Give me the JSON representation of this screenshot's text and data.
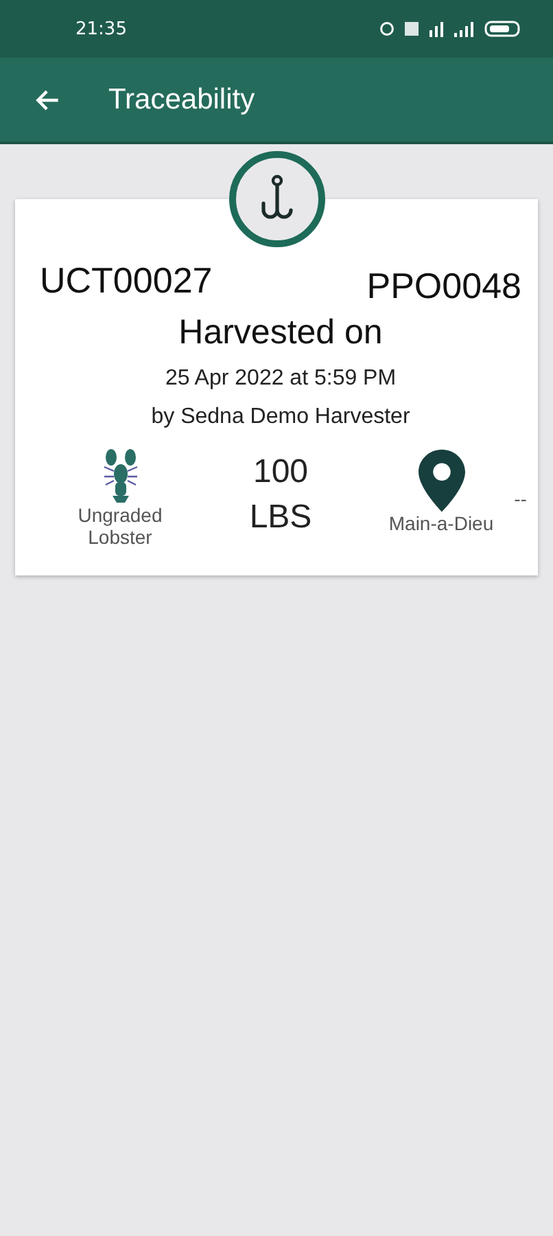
{
  "status_bar": {
    "time": "21:35"
  },
  "app_bar": {
    "title": "Traceability"
  },
  "card": {
    "lot_id": "UCT00027",
    "order_id": "PPO0048",
    "heading": "Harvested on",
    "date": "25 Apr 2022 at 5:59 PM",
    "by": "by Sedna Demo Harvester",
    "species": {
      "label": "Ungraded Lobster"
    },
    "quantity": {
      "amount": "100",
      "unit": "LBS"
    },
    "location": {
      "name": "Main-a-Dieu",
      "extra": "--"
    }
  }
}
